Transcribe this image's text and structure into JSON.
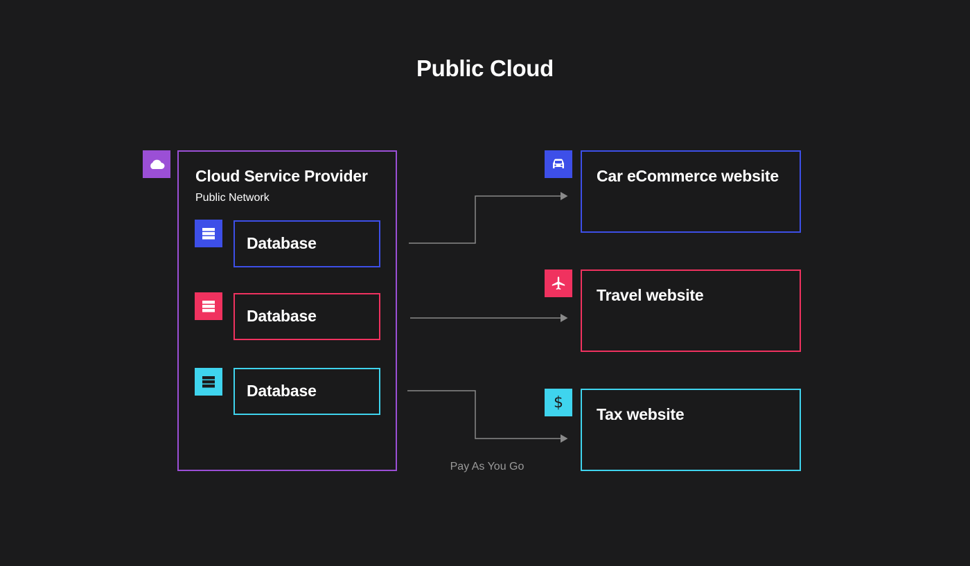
{
  "title": "Public Cloud",
  "colors": {
    "background": "#1b1b1c",
    "purple": "#9b4fd6",
    "blue": "#3d4fe8",
    "red": "#f0325f",
    "cyan": "#3fd4ee",
    "connector": "#8a8a8a"
  },
  "provider": {
    "icon": "cloud-icon",
    "title": "Cloud Service Provider",
    "subtitle": "Public Network",
    "databases": [
      {
        "label": "Database",
        "icon": "database-icon",
        "color": "blue"
      },
      {
        "label": "Database",
        "icon": "database-icon",
        "color": "red"
      },
      {
        "label": "Database",
        "icon": "database-icon",
        "color": "cyan"
      }
    ]
  },
  "sites": [
    {
      "label": "Car eCommerce website",
      "icon": "car-icon",
      "color": "blue"
    },
    {
      "label": "Travel website",
      "icon": "airplane-icon",
      "color": "red"
    },
    {
      "label": "Tax website",
      "icon": "dollar-icon",
      "color": "cyan"
    }
  ],
  "connector_label": "Pay As You Go"
}
